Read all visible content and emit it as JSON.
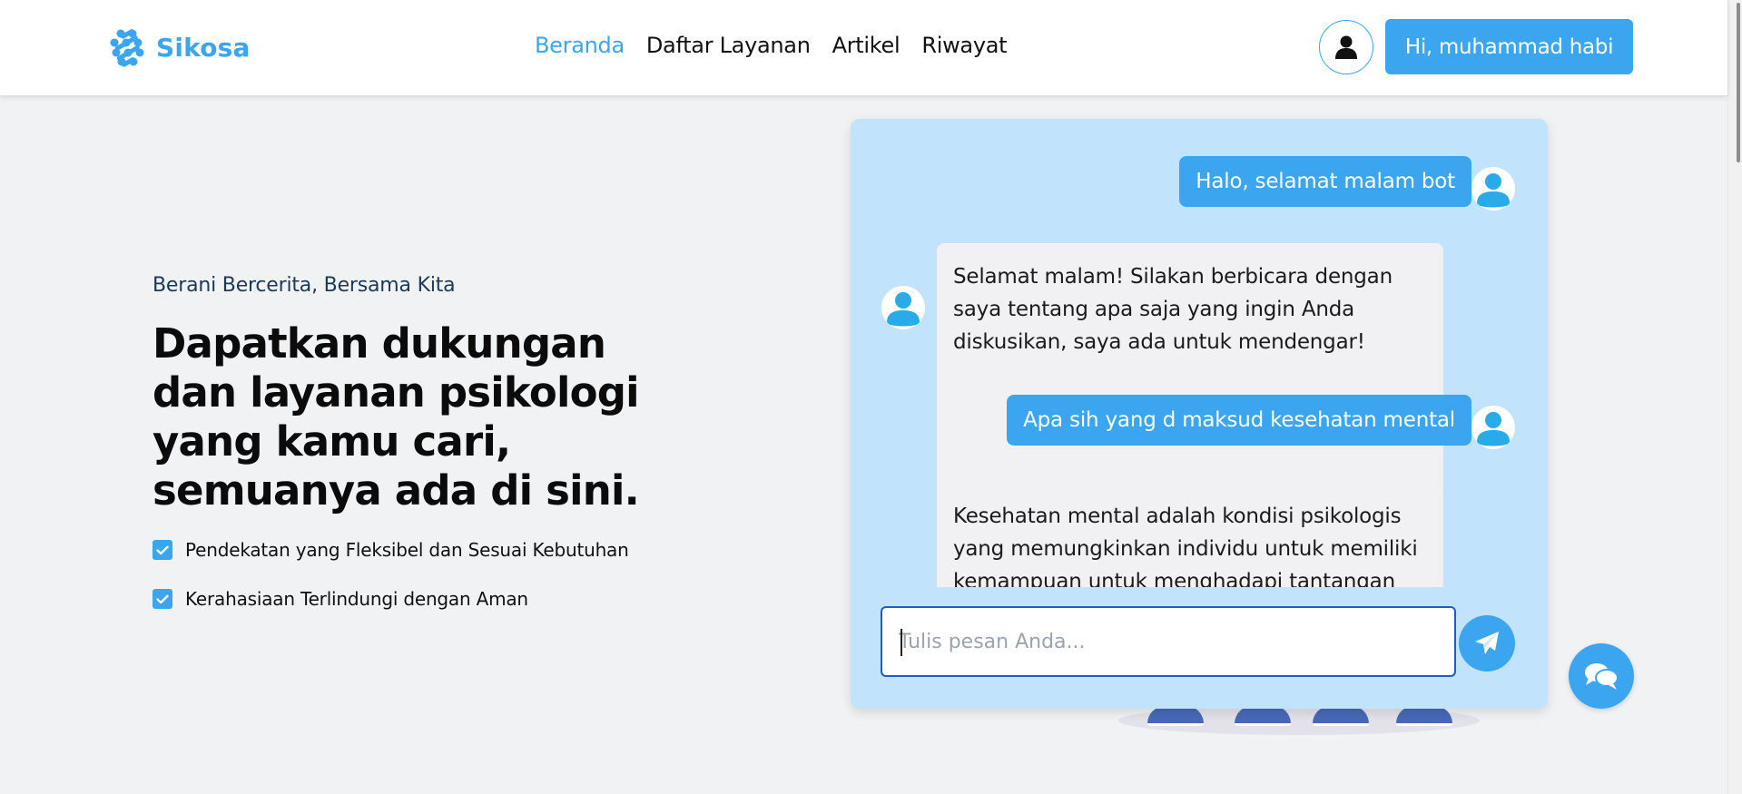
{
  "brand": {
    "name": "Sikosa",
    "logo_icon": "dna-cluster-icon",
    "accent": "#3ba5f0"
  },
  "nav": {
    "links": [
      {
        "label": "Beranda",
        "active": true
      },
      {
        "label": "Daftar Layanan",
        "active": false
      },
      {
        "label": "Artikel",
        "active": false
      },
      {
        "label": "Riwayat",
        "active": false
      }
    ],
    "profile_icon": "user-icon",
    "greeting": "Hi, muhammad habi"
  },
  "hero": {
    "tagline": "Berani Bercerita, Bersama Kita",
    "title": "Dapatkan dukungan dan layanan psikologi yang kamu cari, semuanya ada di sini.",
    "features": [
      "Pendekatan yang Fleksibel dan Sesuai Kebutuhan",
      "Kerahasiaan Terlindungi dengan Aman"
    ]
  },
  "chat": {
    "messages": [
      {
        "from": "user",
        "text": "Halo, selamat malam bot"
      },
      {
        "from": "bot",
        "text": "Selamat malam! Silakan berbicara dengan saya tentang apa saja yang ingin Anda diskusikan, saya ada untuk mendengar!"
      },
      {
        "from": "user",
        "text": "Apa sih yang d maksud kesehatan mental"
      },
      {
        "from": "bot",
        "text": "Kesehatan mental adalah kondisi psikologis yang memungkinkan individu untuk memiliki kemampuan untuk menghadapi tantangan"
      }
    ],
    "input": {
      "placeholder": "Tulis pesan Anda...",
      "value": ""
    },
    "send_icon": "paper-plane-icon",
    "fab_icon": "chat-bubbles-icon",
    "colors": {
      "panel": "#c1e3fb",
      "user_bubble": "#3ba5f0",
      "bot_bubble": "#f1f1f3"
    }
  }
}
